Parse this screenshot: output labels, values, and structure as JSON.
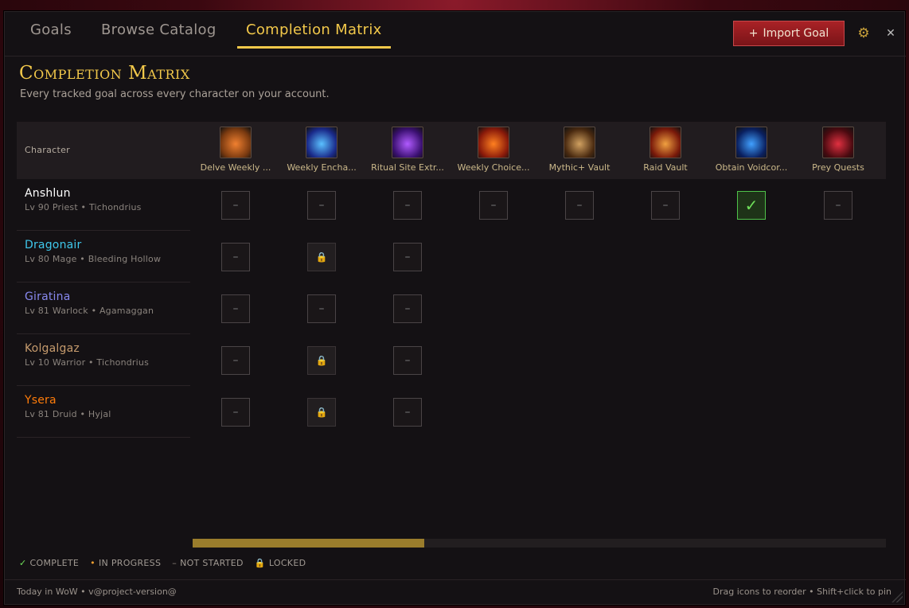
{
  "tabs": [
    {
      "label": "Goals"
    },
    {
      "label": "Browse Catalog"
    },
    {
      "label": "Completion Matrix"
    }
  ],
  "active_tab": "Completion Matrix",
  "import_button": {
    "icon": "+",
    "label": "Import Goal"
  },
  "page": {
    "title": "Completion Matrix",
    "subtitle": "Every tracked goal across every character on your account."
  },
  "matrix": {
    "character_header": "Character",
    "goals": [
      {
        "label": "Delve Weekly ...",
        "icon": "delve-icon",
        "colors": [
          "#7a3a10",
          "#f08030"
        ]
      },
      {
        "label": "Weekly Encha...",
        "icon": "enchant-icon",
        "colors": [
          "#1a2a8a",
          "#5ac0ff"
        ]
      },
      {
        "label": "Ritual Site Extr...",
        "icon": "ritual-icon",
        "colors": [
          "#3a1070",
          "#b05aff"
        ]
      },
      {
        "label": "Weekly Choice...",
        "icon": "choice-icon",
        "colors": [
          "#8a1a0a",
          "#ff8020"
        ]
      },
      {
        "label": "Mythic+ Vault",
        "icon": "vault-icon",
        "colors": [
          "#4a2a10",
          "#d0a060"
        ]
      },
      {
        "label": "Raid Vault",
        "icon": "raid-vault-icon",
        "colors": [
          "#7a1a0a",
          "#f0a040"
        ]
      },
      {
        "label": "Obtain Voidcor...",
        "icon": "voidcore-icon",
        "colors": [
          "#0a2060",
          "#40a0ff"
        ]
      },
      {
        "label": "Prey Quests",
        "icon": "prey-icon",
        "colors": [
          "#4a0a10",
          "#e03040"
        ]
      }
    ],
    "characters": [
      {
        "name": "Anshlun",
        "info": "Lv 90 Priest • Tichondrius",
        "color": "#ffffff",
        "cells": [
          "–",
          "–",
          "–",
          "–",
          "–",
          "–",
          "✓",
          "–"
        ],
        "states": [
          "not-started",
          "not-started",
          "not-started",
          "not-started",
          "not-started",
          "not-started",
          "complete",
          "not-started"
        ]
      },
      {
        "name": "Dragonair",
        "info": "Lv 80 Mage • Bleeding Hollow",
        "color": "#3fc7eb",
        "cells": [
          "–",
          "🔒",
          "–"
        ],
        "states": [
          "not-started",
          "locked",
          "not-started"
        ]
      },
      {
        "name": "Giratina",
        "info": "Lv 81 Warlock • Agamaggan",
        "color": "#8788ee",
        "cells": [
          "–",
          "–",
          "–"
        ],
        "states": [
          "not-started",
          "not-started",
          "not-started"
        ]
      },
      {
        "name": "Kolgalgaz",
        "info": "Lv 10 Warrior • Tichondrius",
        "color": "#c69b6d",
        "cells": [
          "–",
          "🔒",
          "–"
        ],
        "states": [
          "not-started",
          "locked",
          "not-started"
        ]
      },
      {
        "name": "Ysera",
        "info": "Lv 81 Druid • Hyjal",
        "color": "#ff7c0a",
        "cells": [
          "–",
          "🔒",
          "–"
        ],
        "states": [
          "not-started",
          "locked",
          "not-started"
        ]
      }
    ]
  },
  "scrollbar": {
    "position_fraction": 0.0,
    "visible_fraction": 0.334
  },
  "legend": [
    {
      "symbol": "✓",
      "label": "COMPLETE",
      "color": "#6fe05a"
    },
    {
      "symbol": "•",
      "label": "IN PROGRESS",
      "color": "#f2a030"
    },
    {
      "symbol": "–",
      "label": "NOT STARTED",
      "color": "#8a837d"
    },
    {
      "symbol": "🔒",
      "label": "LOCKED",
      "color": "#8a837d"
    }
  ],
  "footer": {
    "left": "Today in WoW  •  v@project-version@",
    "right": "Drag icons to reorder  •  Shift+click to pin"
  }
}
